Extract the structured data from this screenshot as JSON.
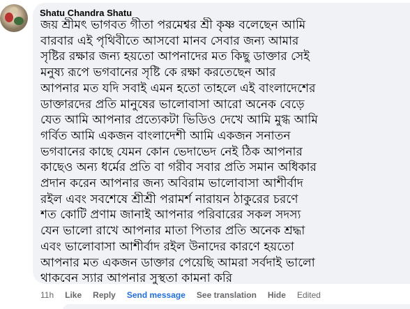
{
  "comment": {
    "author": "Shatu Chandra Shatu",
    "lines": [
      "জয় শ্রীমৎ ভাগবত গীতা পরমেশ্বর শ্রী কৃষ্ণ বলেছেন আমি",
      "বারবার এই পৃথিবীতে আসবো মানব সেবার জন্য আমার",
      "সৃষ্টির রক্ষার জন্য হয়তো আপনাদের মত কিছু ডাক্তার সেই",
      "মনুষ্য রূপে ভগবানের সৃষ্টি কে রক্ষা করতেছেন আর",
      "আপনার মত যদি সবাই এমন হতো তাহলে এই বাংলাদেশের",
      "ডাক্তারদের প্রতি মানুষের ভালোবাসা আরো অনেক বেড়ে",
      "যেত আমি আপনার প্রত্যেকটা ভিডিও দেখে আমি মুগ্ধ আমি",
      "গর্বিত আমি একজন বাংলাদেশী আমি একজন সনাতন",
      "ভগবানের কাছে যেমন কোন ভেদাভেদ নেই ঠিক আপনার",
      "কাছেও অন্য ধর্মের প্রতি বা গরীব সবার প্রতি সমান অধিকার",
      "প্রদান করেন আপনার জন্য অবিরাম ভালোবাসা আশীর্বাদ",
      "রইল এবং সবশেষে শ্রীশ্রী পরামর্শ নারায়ন ঠাকুরের চরণে",
      "শত কোটি প্রণাম জানাই আপনার পরিবারের সকল সদস্য",
      "যেন ভালো রাখে আপনার মাতা পিতার প্রতি অনেক শ্রদ্ধা",
      "এবং ভালোবাসা আশীর্বাদ রইল উনাদের কারণে হয়তো",
      "আপনার মত একজন ডাক্তার পেয়েছি আমরা সর্বদাই ভালো",
      "থাকবেন স্যার আপনার সুস্থতা কামনা করি"
    ]
  },
  "actions": {
    "time": "11h",
    "like": "Like",
    "reply": "Reply",
    "send_message": "Send message",
    "see_translation": "See translation",
    "hide": "Hide",
    "edited": "Edited"
  },
  "colors": {
    "bubble": "#f0f2f5",
    "text": "#050505",
    "meta": "#65676b",
    "link_blue": "#216fdb"
  }
}
